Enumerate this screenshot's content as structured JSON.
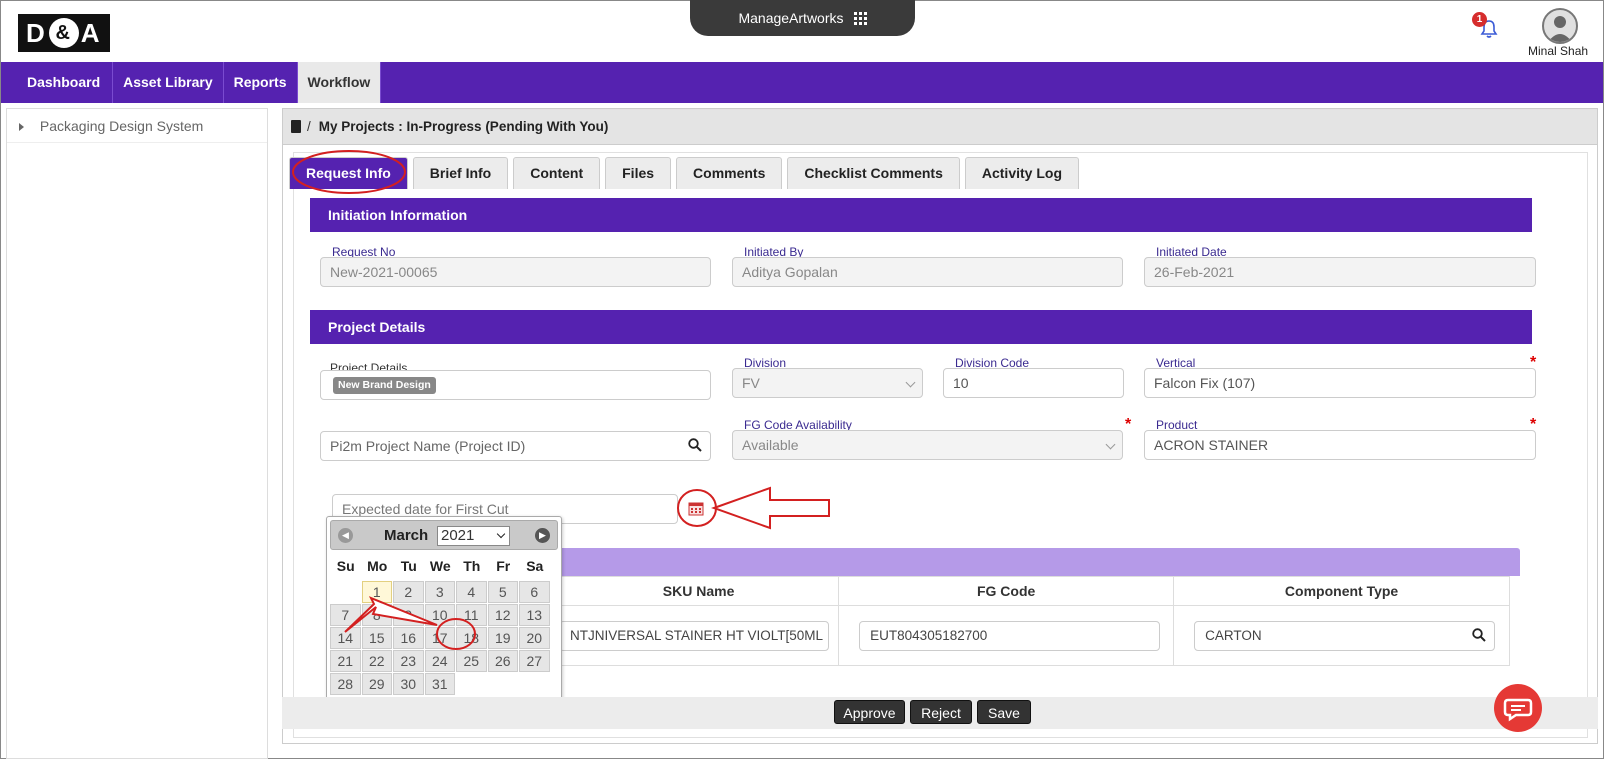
{
  "header": {
    "logo_text": "D&A",
    "app_switcher": "ManageArtworks",
    "notification_count": "1",
    "user_name": "Minal Shah"
  },
  "nav": {
    "items": [
      "Dashboard",
      "Asset Library",
      "Reports",
      "Workflow"
    ],
    "active": "Workflow"
  },
  "sidebar": {
    "items": [
      "Packaging Design System"
    ]
  },
  "breadcrumb": {
    "separator": "/",
    "title": "My Projects : In-Progress (Pending With You)"
  },
  "tabs": [
    "Request Info",
    "Brief Info",
    "Content",
    "Files",
    "Comments",
    "Checklist Comments",
    "Activity Log"
  ],
  "initiation": {
    "heading": "Initiation Information",
    "request_no_label": "Request No",
    "request_no": "New-2021-00065",
    "initiated_by_label": "Initiated By",
    "initiated_by": "Aditya Gopalan",
    "initiated_date_label": "Initiated Date",
    "initiated_date": "26-Feb-2021"
  },
  "project": {
    "heading": "Project Details",
    "details_label": "Project Details",
    "details_chip": "New Brand Design",
    "division_label": "Division",
    "division": "FV",
    "division_code_label": "Division Code",
    "division_code": "10",
    "vertical_label": "Vertical",
    "vertical": "Falcon Fix (107)",
    "pi2m_placeholder": "Pi2m Project Name (Project ID)",
    "fg_label": "FG Code Availability",
    "fg": "Available",
    "product_label": "Product",
    "product": "ACRON STAINER",
    "expected_placeholder": "Expected date for First Cut"
  },
  "sku_table": {
    "columns": [
      "SKU Name",
      "FG Code",
      "Component Type"
    ],
    "row": {
      "sku": "NTJNIVERSAL STAINER HT VIOLT[50ML",
      "fg": "EUT804305182700",
      "component": "CARTON"
    }
  },
  "calendar": {
    "month": "March",
    "year": "2021",
    "dow": [
      "Su",
      "Mo",
      "Tu",
      "We",
      "Th",
      "Fr",
      "Sa"
    ],
    "days": [
      "",
      "1",
      "2",
      "3",
      "4",
      "5",
      "6",
      "7",
      "8",
      "9",
      "10",
      "11",
      "12",
      "13",
      "14",
      "15",
      "16",
      "17",
      "18",
      "19",
      "20",
      "21",
      "22",
      "23",
      "24",
      "25",
      "26",
      "27",
      "28",
      "29",
      "30",
      "31"
    ]
  },
  "buttons": {
    "approve": "Approve",
    "reject": "Reject",
    "save": "Save"
  },
  "colors": {
    "brand": "#5522b0",
    "annotation": "#d32020"
  }
}
